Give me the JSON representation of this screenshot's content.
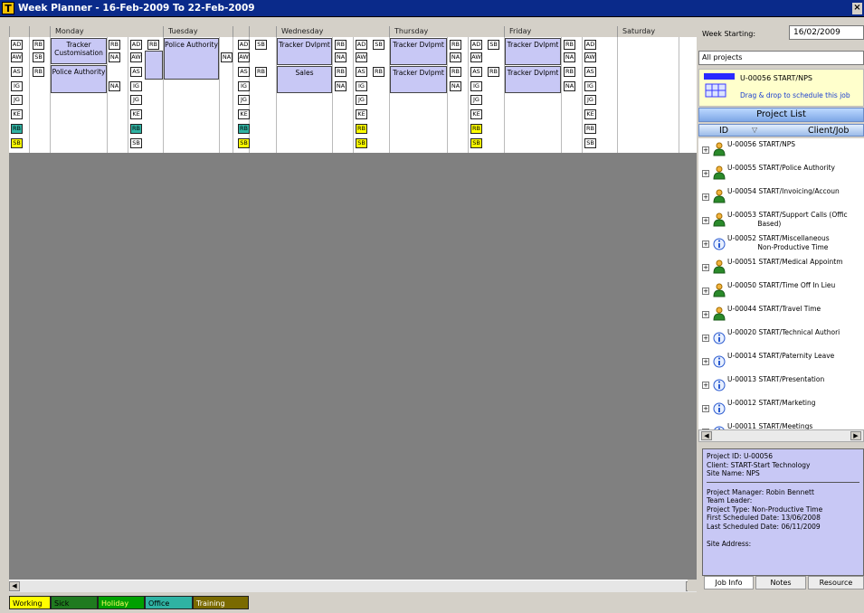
{
  "window": {
    "title": "Week Planner - 16-Feb-2009 To 22-Feb-2009",
    "app_icon": "T",
    "close_glyph": "×"
  },
  "days": [
    "Monday",
    "Tuesday",
    "Wednesday",
    "Thursday",
    "Friday",
    "Saturday"
  ],
  "staff_tags": {
    "mon_a": [
      "AD",
      "AW",
      "AS",
      "IG",
      "JG",
      "KE",
      "RB",
      "SB"
    ],
    "mon_b": [
      "RB",
      "SB",
      "RB"
    ],
    "mon_c": [
      "RB",
      "NA",
      "",
      "NA"
    ],
    "mon_d": [
      "AD",
      "AW",
      "AS",
      "IG",
      "JG",
      "KE",
      "RB",
      "SB"
    ],
    "mon_e": [
      "RB"
    ],
    "tue_a": [
      "NA"
    ],
    "tue_b": [
      "AD",
      "AW",
      "AS",
      "IG",
      "JG",
      "KE",
      "RB",
      "SB"
    ],
    "tue_c": [
      "SB",
      "",
      "RB"
    ],
    "wed_a": [
      "RB",
      "NA",
      "RB",
      "NA"
    ],
    "wed_b": [
      "AD",
      "AW",
      "AS",
      "IG",
      "JG",
      "KE",
      "RB",
      "SB"
    ],
    "wed_c": [
      "SB",
      "",
      "RB"
    ],
    "thu_a": [
      "RB",
      "NA",
      "RB",
      "NA"
    ],
    "thu_b": [
      "AD",
      "AW",
      "AS",
      "IG",
      "JG",
      "KE",
      "RB",
      "SB"
    ],
    "thu_c": [
      "SB",
      "",
      "RB"
    ],
    "fri_a": [
      "RB",
      "NA",
      "RB",
      "NA"
    ],
    "fri_b": [
      "AD",
      "AW",
      "AS",
      "IG",
      "JG",
      "KE",
      "RB",
      "SB"
    ]
  },
  "jobs": {
    "mon_1": "Tracker Customisation",
    "mon_2": "Police Authority",
    "tue_1": "Police Authority",
    "wed_1": "Tracker Dvlpmt",
    "wed_2": "Sales",
    "thu_1": "Tracker Dvlpmt",
    "thu_2": "Tracker Dvlpmt",
    "fri_1": "Tracker Dvlpmt",
    "fri_2": "Tracker Dvlpmt"
  },
  "legend": [
    {
      "label": "Working",
      "color": "#ffff00",
      "text": "#000000"
    },
    {
      "label": "Sick",
      "color": "#1f7a1f",
      "text": "#000000"
    },
    {
      "label": "Holiday",
      "color": "#00a000",
      "text": "#ffff66"
    },
    {
      "label": "Office",
      "color": "#2fb3a3",
      "text": "#000000"
    },
    {
      "label": "Training",
      "color": "#7a6a00",
      "text": "#ffffff"
    }
  ],
  "sidebar": {
    "week_starting_label": "Week Starting:",
    "week_starting_value": "16/02/2009",
    "project_filter": "All projects",
    "drag_title": "U-00056 START/NPS",
    "drag_hint": "Drag & drop to schedule this job",
    "project_list_title": "Project List",
    "col_id": "ID",
    "col_client": "Client/Job",
    "sort_glyph": "▽",
    "projects": [
      {
        "text": "U-00056 START/NPS",
        "icon": "person-icon"
      },
      {
        "text": "U-00055 START/Police Authority",
        "icon": "person-icon"
      },
      {
        "text": "U-00054 START/Invoicing/Accoun",
        "icon": "person-icon"
      },
      {
        "text": "U-00053 START/Support Calls (Offic\n              Based)",
        "icon": "person-icon"
      },
      {
        "text": "U-00052 START/Miscellaneous\n              Non-Productive Time",
        "icon": "info-icon"
      },
      {
        "text": "U-00051 START/Medical Appointm",
        "icon": "person-icon"
      },
      {
        "text": "U-00050 START/Time Off In Lieu",
        "icon": "person-icon"
      },
      {
        "text": "U-00044 START/Travel Time",
        "icon": "person-icon"
      },
      {
        "text": "U-00020 START/Technical Authori",
        "icon": "info-icon"
      },
      {
        "text": "U-00014 START/Paternity Leave",
        "icon": "info-icon"
      },
      {
        "text": "U-00013 START/Presentation",
        "icon": "info-icon"
      },
      {
        "text": "U-00012 START/Marketing",
        "icon": "info-icon"
      },
      {
        "text": "U-00011 START/Meetings",
        "icon": "info-icon"
      }
    ],
    "info": {
      "project_id": "Project ID: U-00056",
      "client": "Client: START-Start Technology",
      "site": "Site Name: NPS",
      "manager": "Project Manager: Robin Bennett",
      "leader": "Team Leader:",
      "type": "Project Type: Non-Productive Time",
      "first": "First Scheduled Date: 13/06/2008",
      "last": "Last Scheduled Date: 06/11/2009",
      "address": "Site Address:"
    },
    "tabs": [
      "Job Info",
      "Notes",
      "Resource"
    ]
  }
}
